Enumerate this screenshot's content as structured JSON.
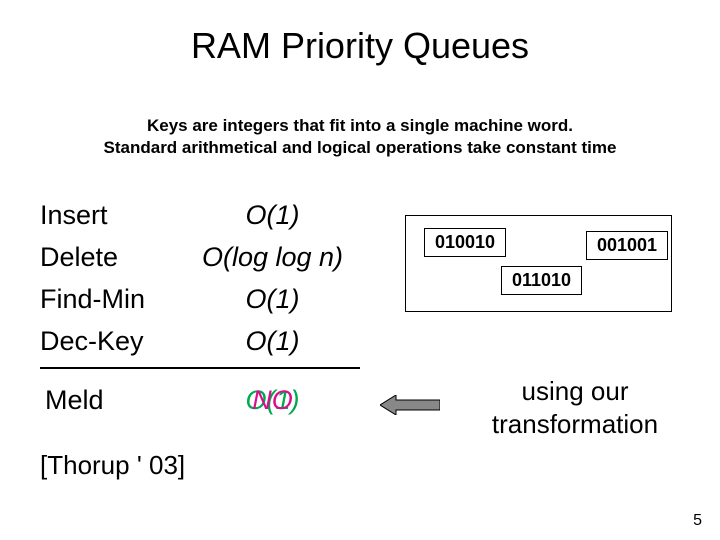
{
  "title": "RAM Priority Queues",
  "subtitle_l1": "Keys are integers that fit into a single machine word.",
  "subtitle_l2": "Standard arithmetical and logical operations take constant time",
  "ops": {
    "insert": {
      "name": "Insert",
      "val": "O(1)"
    },
    "delete": {
      "name": "Delete",
      "val": "O(log log n)"
    },
    "findmin": {
      "name": "Find-Min",
      "val": "O(1)"
    },
    "deckey": {
      "name": "Dec-Key",
      "val": "O(1)"
    }
  },
  "meld": {
    "name": "Meld",
    "o1": "O(1)",
    "no": "NO"
  },
  "citation": "[Thorup ' 03]",
  "bits": {
    "a": "010010",
    "b": "001001",
    "c": "011010"
  },
  "transform_l1": "using our",
  "transform_l2": "transformation",
  "pagenum": "5"
}
